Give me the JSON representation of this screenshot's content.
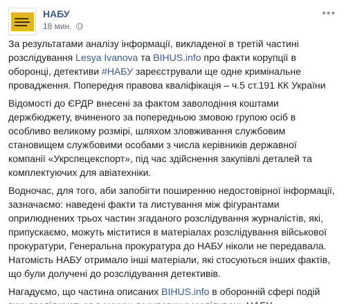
{
  "post": {
    "page_name": "НАБУ",
    "timestamp": "18 мин.",
    "menu_icon": "more-dots-icon",
    "privacy_icon": "globe-icon",
    "p1": {
      "a": "За результатами аналізу інформації, викладеної в третій частині розслідування ",
      "link1": "Lesya Ivanova",
      "b": " та ",
      "link2": "BIHUS.info",
      "c": " про факти корупції в оборонці, детективи ",
      "hashtag": "#НАБУ",
      "d": " зареєстрували ще одне кримінальне провадження. Попередня правова кваліфікація – ч.5 ст.191 КК України"
    },
    "p2": "Відомості до ЄРДР внесені за фактом заволодіння коштами держбюджету, вчиненого за попередньою змовою групою осіб в особливо великому розмірі, шляхом зловживання службовим становищем службовими особами з числа керівників державної компанії «Укрспецекспорт», під час здійснення закупівлі деталей та комплектуючих для авіатехніки.",
    "p3": "Водночас, для того, аби запобігти поширенню недостовірної інформації, зазначаємо: наведені факти та листування між фігурантами оприлюднених трьох частин згаданого розслідування журналістів, які, припускаємо, можуть міститися в матеріалах розслідування військової прокуратури, Генеральна прокуратура до НАБУ ніколи не передавала. Натомість НАБУ отримало інші матеріали, які стосуються інших фактів, що були долучені до розслідування детективів.",
    "p4": {
      "a": "Нагадуємо, що частина описаних ",
      "link": "BIHUS.info",
      "b": " в оборонній сфері подій вже досліджується в межах досудових розслідувань НАБУ."
    }
  }
}
